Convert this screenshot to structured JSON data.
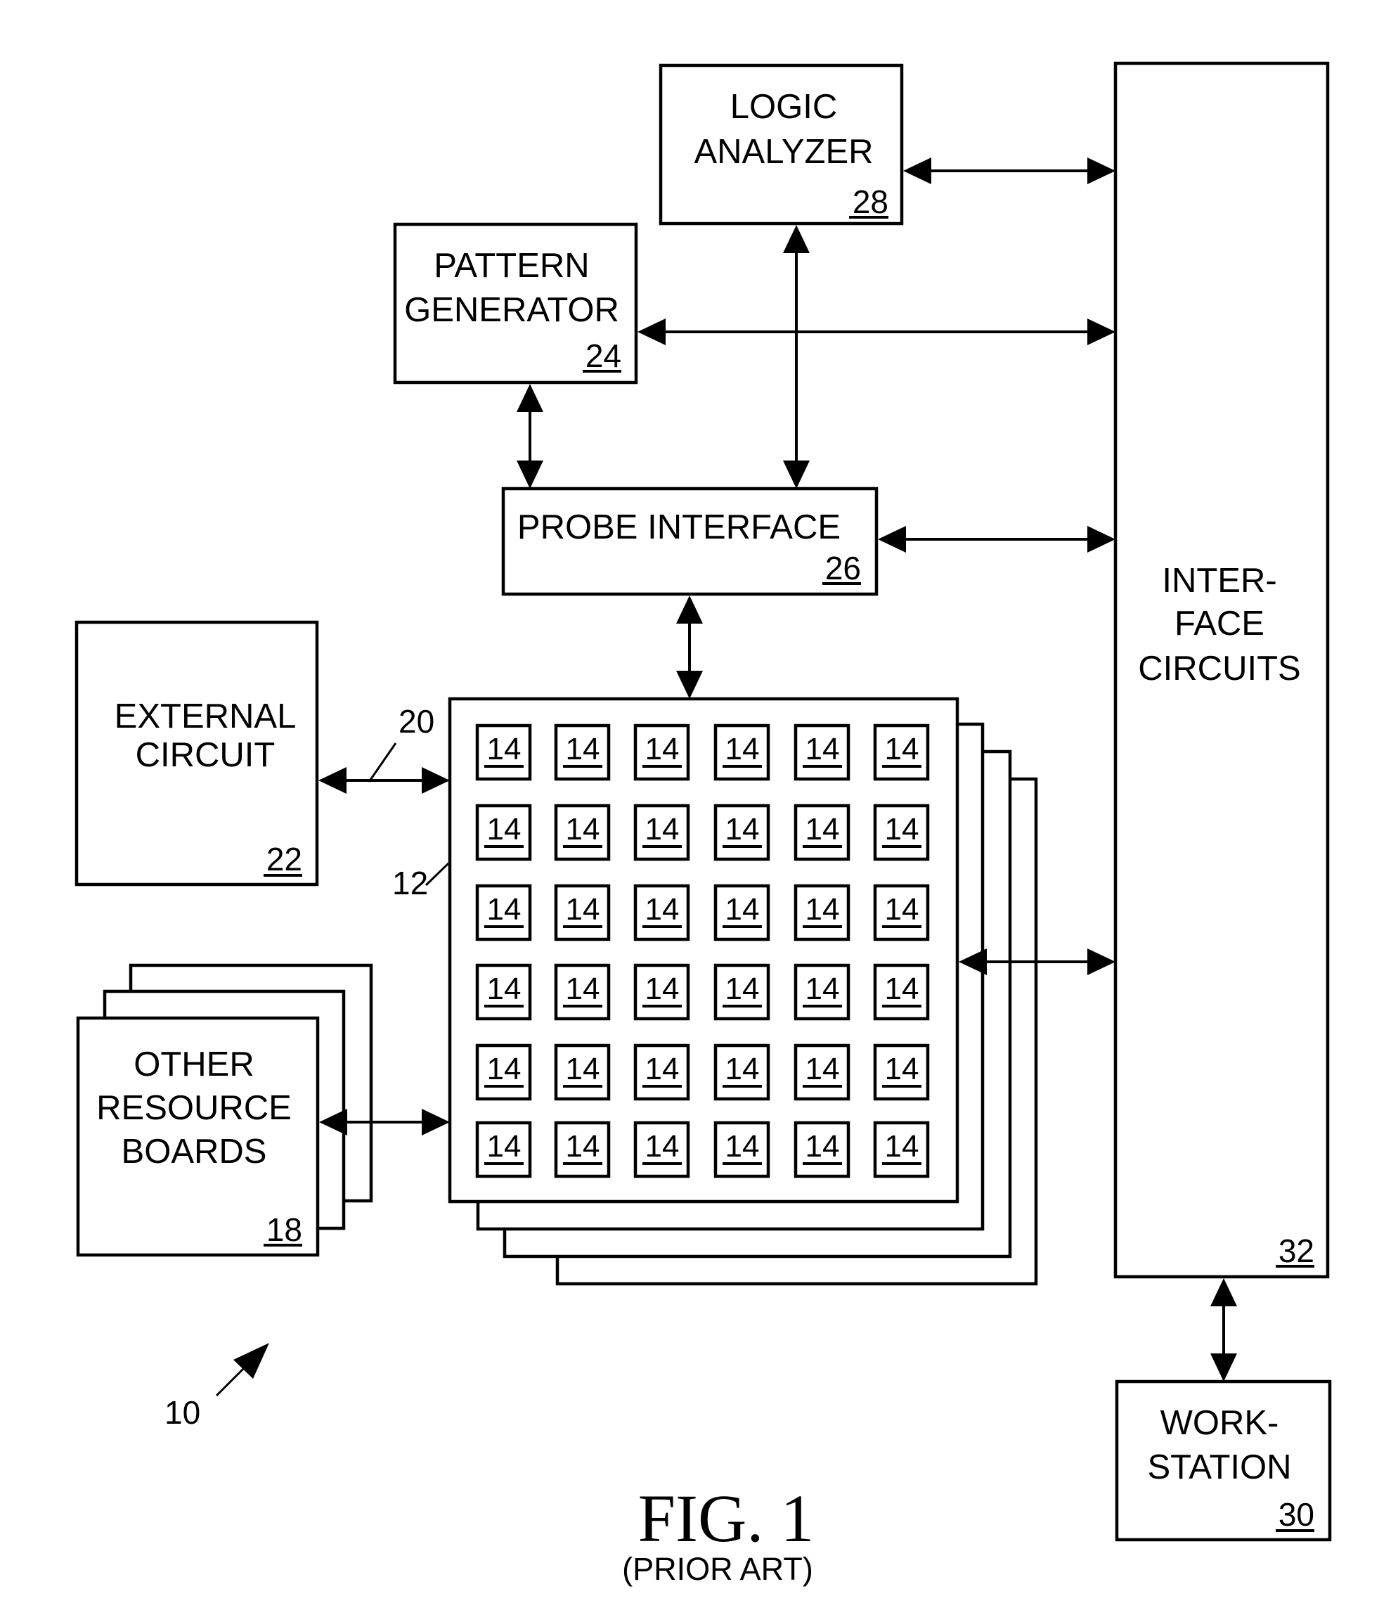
{
  "figure": {
    "title": "FIG. 1",
    "subtitle": "(PRIOR ART)",
    "system_ref": "10"
  },
  "blocks": {
    "logic_analyzer": {
      "lines": [
        "LOGIC",
        "ANALYZER"
      ],
      "ref": "28"
    },
    "pattern_generator": {
      "lines": [
        "PATTERN",
        "GENERATOR"
      ],
      "ref": "24"
    },
    "probe_interface": {
      "lines": [
        "PROBE INTERFACE"
      ],
      "ref": "26"
    },
    "interface_circuits": {
      "lines": [
        "INTER-",
        "FACE",
        "CIRCUITS"
      ],
      "ref": "32"
    },
    "workstation": {
      "lines": [
        "WORK-",
        "STATION"
      ],
      "ref": "30"
    },
    "external_circuit": {
      "lines": [
        "EXTERNAL",
        "CIRCUIT"
      ],
      "ref": "22"
    },
    "other_resource_boards": {
      "lines": [
        "OTHER",
        "RESOURCE",
        "BOARDS"
      ],
      "ref": "18"
    }
  },
  "board": {
    "ref": "12",
    "bus_ref": "20",
    "stacked_count": 4,
    "grid_rows": 6,
    "grid_cols": 6,
    "cell_ref": "14"
  },
  "connections": [
    {
      "from": "logic_analyzer",
      "to": "interface_circuits",
      "type": "bidirectional"
    },
    {
      "from": "pattern_generator",
      "to": "interface_circuits",
      "type": "bidirectional"
    },
    {
      "from": "logic_analyzer",
      "to": "probe_interface",
      "type": "bidirectional"
    },
    {
      "from": "pattern_generator",
      "to": "probe_interface",
      "type": "bidirectional"
    },
    {
      "from": "probe_interface",
      "to": "interface_circuits",
      "type": "bidirectional"
    },
    {
      "from": "probe_interface",
      "to": "board",
      "type": "bidirectional"
    },
    {
      "from": "external_circuit",
      "to": "board",
      "type": "bidirectional"
    },
    {
      "from": "other_resource_boards",
      "to": "board",
      "type": "bidirectional"
    },
    {
      "from": "board",
      "to": "interface_circuits",
      "type": "bidirectional"
    },
    {
      "from": "interface_circuits",
      "to": "workstation",
      "type": "bidirectional"
    }
  ]
}
